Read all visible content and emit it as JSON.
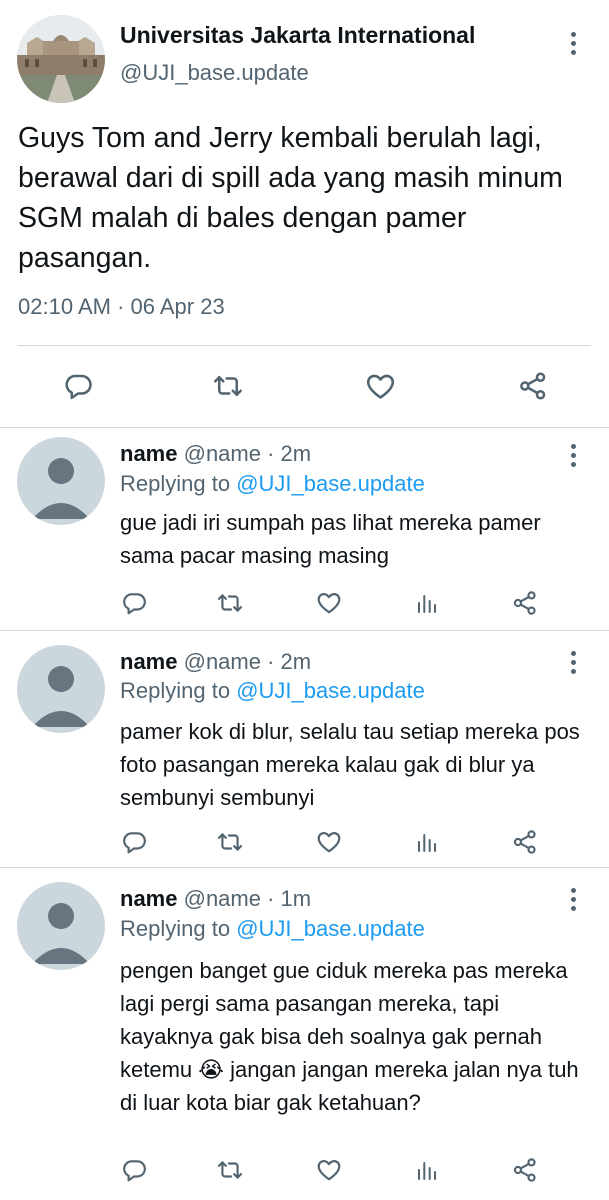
{
  "main_tweet": {
    "author_name": "Universitas Jakarta International",
    "author_handle": "@UJI_base.update",
    "text": "Guys Tom and Jerry kembali berulah lagi, berawal dari di spill ada yang masih minum SGM malah di bales dengan pamer pasangan.",
    "timestamp": "02:10 AM · 06 Apr 23"
  },
  "replies": [
    {
      "name": "name",
      "meta": "@name · 2m",
      "replying_prefix": "Replying to",
      "replying_handle": "@UJI_base.update",
      "text": "gue jadi iri sumpah pas lihat mereka pamer sama pacar masing masing"
    },
    {
      "name": "name",
      "meta": "@name · 2m",
      "replying_prefix": "Replying to",
      "replying_handle": "@UJI_base.update",
      "text": "pamer kok di blur, selalu tau setiap mereka pos foto pasangan mereka kalau gak di blur ya sembunyi sembunyi"
    },
    {
      "name": "name",
      "meta": "@name · 1m",
      "replying_prefix": "Replying to",
      "replying_handle": "@UJI_base.update",
      "text": "pengen banget gue ciduk mereka pas mereka lagi pergi sama pasangan mereka, tapi kayaknya gak bisa deh soalnya gak pernah ketemu 😭 jangan jangan mereka jalan nya tuh di luar kota biar gak ketahuan?"
    }
  ],
  "colors": {
    "text_primary": "#0f1419",
    "text_secondary": "#536471",
    "mention": "#1d9bf0",
    "divider": "#cfd9de",
    "avatar_placeholder_bg": "#ccd6dd",
    "avatar_placeholder_fg": "#66757f"
  },
  "icons": {
    "more": "more-vertical-icon",
    "reply": "reply-icon",
    "retweet": "retweet-icon",
    "like": "heart-icon",
    "share": "share-icon",
    "analytics": "analytics-icon"
  }
}
